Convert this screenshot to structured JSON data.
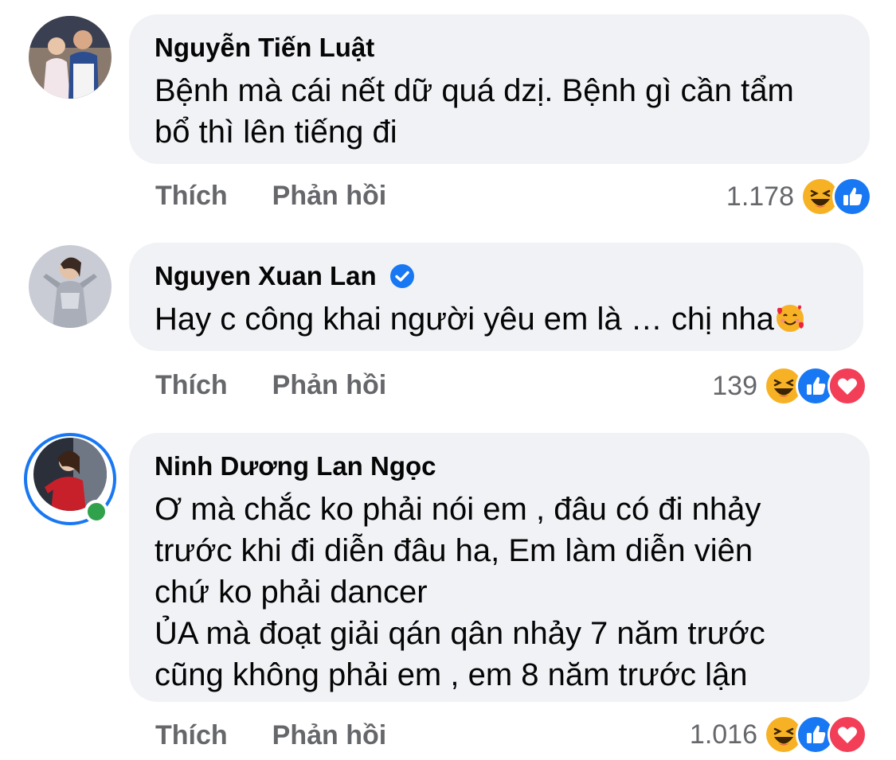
{
  "comments": [
    {
      "author": "Nguyễn Tiến Luật",
      "verified": false,
      "lines": [
        "Bệnh mà cái nết dữ quá dzị. Bệnh gì cần tẩm",
        "bổ thì lên tiếng đi"
      ],
      "like_label": "Thích",
      "reply_label": "Phản hồi",
      "reaction_count": "1.178",
      "reactions": [
        "haha-icon",
        "like-icon"
      ]
    },
    {
      "author": "Nguyen Xuan Lan",
      "verified": true,
      "lines": [
        "Hay c công khai người yêu em là … chị nha"
      ],
      "inline_emoji": "smiling-face-with-hearts-icon",
      "like_label": "Thích",
      "reply_label": "Phản hồi",
      "reaction_count": "139",
      "reactions": [
        "haha-icon",
        "like-icon",
        "love-icon"
      ]
    },
    {
      "author": "Ninh Dương Lan Ngọc",
      "verified": false,
      "online": true,
      "lines": [
        "Ơ mà chắc ko phải nói em , đâu có đi nhảy",
        "trước khi đi diễn đâu ha, Em làm diễn viên",
        "chứ ko phải dancer",
        "ỦA mà đoạt giải qán qân nhảy 7 năm trước",
        "cũng không phải em , em 8 năm trước lận"
      ],
      "like_label": "Thích",
      "reply_label": "Phản hồi",
      "reaction_count": "1.016",
      "reactions": [
        "haha-icon",
        "like-icon",
        "love-icon"
      ]
    }
  ],
  "colors": {
    "bubble": "#f0f2f5",
    "action_text": "#65676b",
    "like_blue": "#1877f2",
    "love_red": "#f33e58",
    "haha_yellow": "#f7b125",
    "online_green": "#31a24c"
  }
}
